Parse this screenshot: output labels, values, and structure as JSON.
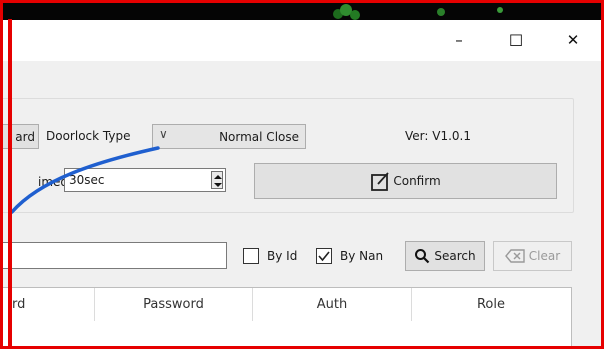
{
  "window": {
    "minimize_glyph": "–",
    "maximize_glyph": "☐",
    "close_glyph": "✕"
  },
  "settings": {
    "left_button_partial": "ard",
    "doorlock_label": "Doorlock Type",
    "doorlock_value": "Normal Close",
    "version": "Ver: V1.0.1",
    "timeout_label_partial": "imeout",
    "timeout_value": "30sec",
    "confirm_label": "Confirm"
  },
  "search": {
    "by_id_label": "By Id",
    "by_id_checked": false,
    "by_name_label": "By Nan",
    "by_name_checked": true,
    "search_button": "Search",
    "clear_button": "Clear"
  },
  "table": {
    "columns": [
      "rd",
      "Password",
      "Auth",
      "Role"
    ]
  },
  "colors": {
    "annotation_frame": "#e60000",
    "annotation_arrow": "#1f5fcf"
  }
}
